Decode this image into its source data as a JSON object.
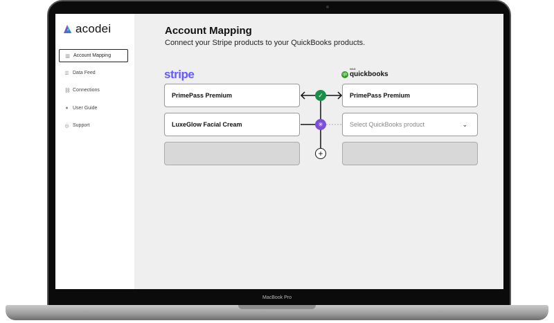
{
  "brand": {
    "name": "acodei"
  },
  "sidebar": {
    "items": [
      {
        "label": "Account Mapping",
        "icon": "columns-icon",
        "active": true
      },
      {
        "label": "Data Feed",
        "icon": "list-icon"
      },
      {
        "label": "Connections",
        "icon": "link-icon"
      },
      {
        "label": "User Guide",
        "icon": "info-icon"
      },
      {
        "label": "Support",
        "icon": "lifebuoy-icon"
      }
    ]
  },
  "header": {
    "title": "Account Mapping",
    "subtitle": "Connect your Stripe products to your QuickBooks products."
  },
  "stripe": {
    "logo": "stripe",
    "products": [
      "PrimePass Premium",
      "LuxeGlow Facial Cream"
    ]
  },
  "quickbooks": {
    "logo": "quickbooks",
    "logo_small": "intuit",
    "products": [
      "PrimePass Premium"
    ],
    "select_placeholder": "Select QuickBooks product"
  },
  "colors": {
    "matched": "#1a8f4a",
    "pending": "#7b4fd6",
    "stripe": "#635bff",
    "qb": "#2ca01c"
  },
  "device": {
    "label": "MacBook Pro"
  }
}
